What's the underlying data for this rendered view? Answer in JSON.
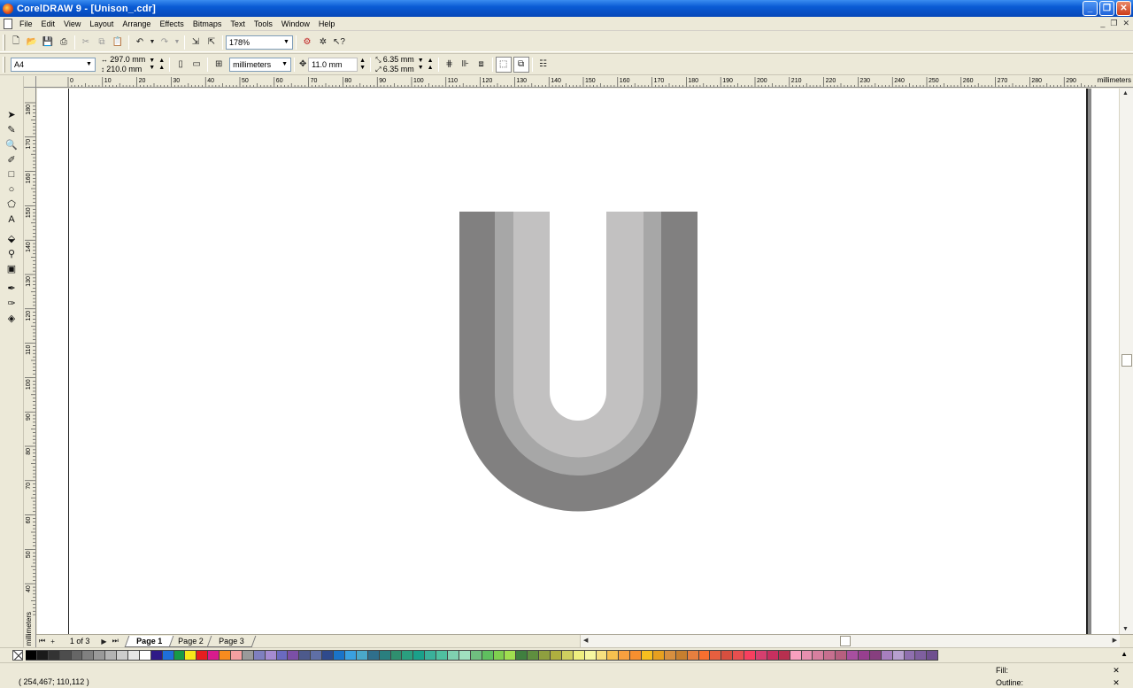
{
  "window": {
    "title": "CorelDRAW 9 - [Unison_.cdr]",
    "minimize": "_",
    "maximize": "❐",
    "close": "✕"
  },
  "menu": [
    "File",
    "Edit",
    "View",
    "Layout",
    "Arrange",
    "Effects",
    "Bitmaps",
    "Text",
    "Tools",
    "Window",
    "Help"
  ],
  "toolbar": {
    "zoom_value": "178%"
  },
  "property_bar": {
    "paper_size": "A4",
    "width": "297.0 mm",
    "height": "210.0 mm",
    "units": "millimeters",
    "nudge": "11.0 mm",
    "duplicate_x": "6.35 mm",
    "duplicate_y": "6.35 mm"
  },
  "rulers": {
    "corner_label": "⁰⁄₀",
    "unit": "millimeters",
    "h_ticks": [
      "0",
      "10",
      "20",
      "30",
      "40",
      "50",
      "60",
      "70",
      "80",
      "90",
      "100",
      "110",
      "120",
      "130",
      "140",
      "150",
      "160",
      "170",
      "180",
      "190",
      "200",
      "210",
      "220",
      "230",
      "240",
      "250",
      "260",
      "270",
      "280",
      "290"
    ],
    "v_ticks": [
      "180",
      "170",
      "160",
      "150",
      "140",
      "130",
      "120",
      "110",
      "100",
      "90",
      "80",
      "70",
      "60",
      "50",
      "40"
    ],
    "v_unit": "millimeters"
  },
  "artwork": {
    "outer_color": "#818080",
    "middle_color": "#a7a7a7",
    "inner_color": "#c2c1c1"
  },
  "pages": {
    "count_label": "1 of 3",
    "tabs": [
      "Page 1",
      "Page 2",
      "Page 3"
    ],
    "active": "Page 1"
  },
  "palette": {
    "colors": [
      "#000000",
      "#1a1a1a",
      "#333333",
      "#4d4d4d",
      "#666666",
      "#808080",
      "#999999",
      "#b3b3b3",
      "#cccccc",
      "#e6e6e6",
      "#ffffff",
      "#2e1a87",
      "#1e6fd9",
      "#179a47",
      "#f7e81a",
      "#e61e1e",
      "#d81b8c",
      "#f78b1e",
      "#f5a0a0",
      "#9a9a9a",
      "#7f7fbf",
      "#a58bd1",
      "#6a6ac0",
      "#7b4fa6",
      "#4d5a8c",
      "#5f6fa6",
      "#2f4a8c",
      "#1a73c9",
      "#3aa0e0",
      "#4aa8c9",
      "#2f6f8c",
      "#2a7f7f",
      "#2f8f6f",
      "#2a9f7f",
      "#1aa08a",
      "#3ab09a",
      "#4fc0a0",
      "#7fd0b0",
      "#a0e0c0",
      "#6fbf7f",
      "#5fbf5f",
      "#7fcf4f",
      "#a0df4f",
      "#3f7f3f",
      "#5f8f3f",
      "#8f9f3f",
      "#afaf3f",
      "#cfcf5f",
      "#efef7f",
      "#f7f7a0",
      "#f7e07f",
      "#f7c04f",
      "#f7a03f",
      "#f78f2f",
      "#f7bf1f",
      "#e7a01f",
      "#d78f3f",
      "#c77f2f",
      "#e77f3f",
      "#f76f2f",
      "#e75f3f",
      "#d74f3f",
      "#e74f4f",
      "#f73f5f",
      "#d73f6f",
      "#c72f5f",
      "#b72f4f",
      "#f79fbf",
      "#e78faf",
      "#d77f9f",
      "#c76f8f",
      "#b75f7f",
      "#a74f9f",
      "#973f8f",
      "#873f7f",
      "#a77fbf",
      "#b79fcf",
      "#8f6faf",
      "#7f5f9f",
      "#6f4f8f"
    ]
  },
  "status": {
    "coordinates": "( 254,467; 110,112 )",
    "fill_label": "Fill:",
    "outline_label": "Outline:",
    "fill_value": "✕",
    "outline_value": "✕"
  }
}
